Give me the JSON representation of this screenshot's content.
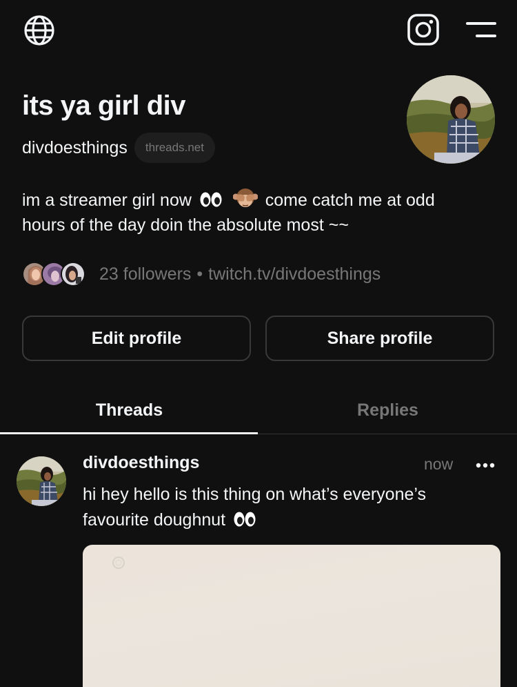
{
  "topbar": {
    "left_icon": "globe-icon",
    "right_icons": [
      "instagram-icon",
      "menu-icon"
    ]
  },
  "profile": {
    "display_name": "its ya girl div",
    "handle": "divdoesthings",
    "domain_badge": "threads.net",
    "bio_part1": "im a streamer girl now",
    "bio_part2": "come catch me at odd hours of the day doin the absolute most ~~",
    "followers": "23 followers",
    "separator": "•",
    "link": "twitch.tv/divdoesthings"
  },
  "buttons": {
    "edit": "Edit profile",
    "share": "Share profile"
  },
  "tabs": [
    {
      "label": "Threads",
      "active": true
    },
    {
      "label": "Replies",
      "active": false
    }
  ],
  "post": {
    "username": "divdoesthings",
    "time": "now",
    "text": "hi hey hello is this thing on what’s everyone’s favourite doughnut"
  },
  "colors": {
    "background": "#101010",
    "text_primary": "#f3f5f7",
    "text_secondary": "#777777",
    "border": "#393939"
  }
}
